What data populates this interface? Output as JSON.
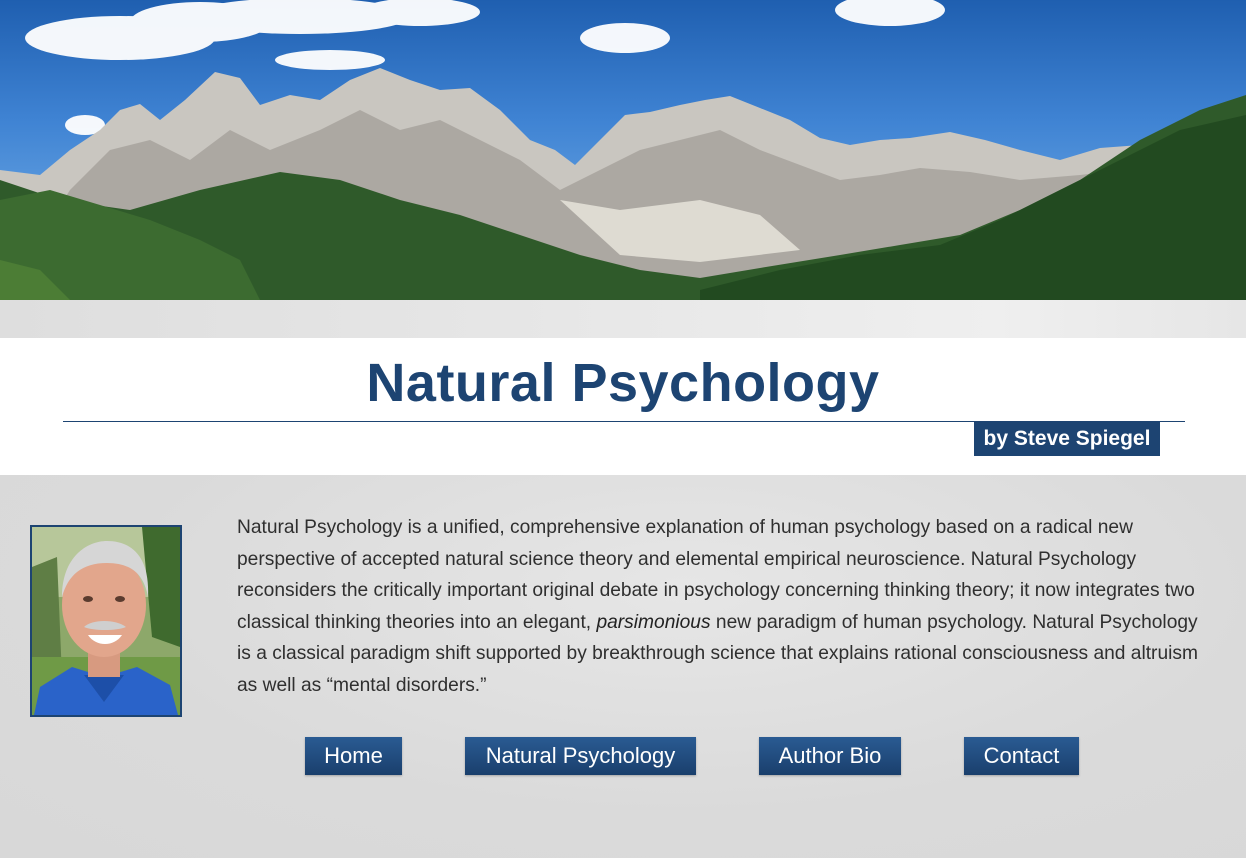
{
  "header": {
    "title": "Natural Psychology",
    "byline": "by Steve Spiegel"
  },
  "colors": {
    "brand_navy": "#1d4472",
    "page_background": "#dcdcdc",
    "text": "#2f2f2f"
  },
  "hero": {
    "image": "mountain-landscape-banner"
  },
  "author_photo": {
    "image": "author-portrait"
  },
  "intro": {
    "part1": "Natural Psychology is a unified, comprehensive explanation of human psychology based on a radical new perspective of accepted natural science theory and elemental empirical neuroscience. Natural Psychology reconsiders the critically important original debate in psychology concerning thinking theory; it now integrates two classical thinking theories into an elegant, ",
    "emphasis": "parsimonious",
    "part2": " new paradigm of human psychology. Natural Psychology is a classical paradigm shift supported by breakthrough science that explains rational consciousness and altruism as well as “mental disorders.”"
  },
  "nav": {
    "items": [
      {
        "label": "Home"
      },
      {
        "label": "Natural Psychology"
      },
      {
        "label": "Author Bio"
      },
      {
        "label": "Contact"
      }
    ]
  }
}
